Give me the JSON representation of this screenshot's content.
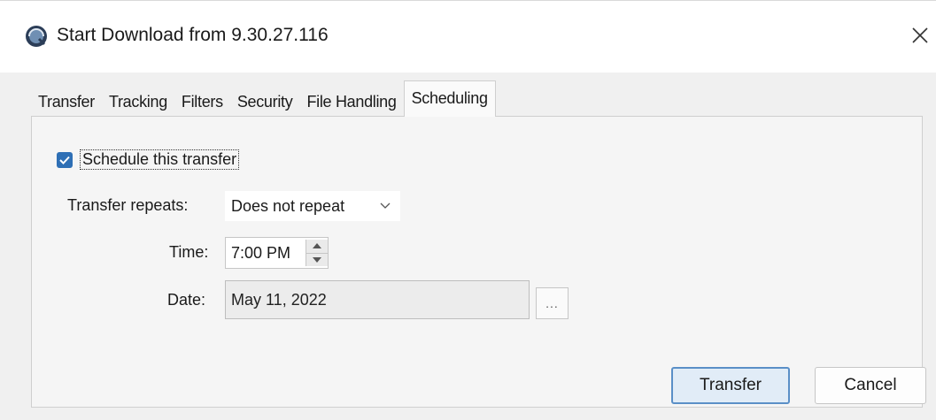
{
  "window": {
    "title": "Start Download from 9.30.27.116",
    "app_icon": "app-globe-icon",
    "close_icon": "close-icon"
  },
  "tabs": [
    {
      "label": "Transfer",
      "active": false
    },
    {
      "label": "Tracking",
      "active": false
    },
    {
      "label": "Filters",
      "active": false
    },
    {
      "label": "Security",
      "active": false
    },
    {
      "label": "File Handling",
      "active": false
    },
    {
      "label": "Scheduling",
      "active": true
    }
  ],
  "scheduling": {
    "schedule_checkbox": {
      "label": "Schedule this transfer",
      "checked": true
    },
    "repeats": {
      "label": "Transfer repeats:",
      "value": "Does not repeat"
    },
    "time": {
      "label": "Time:",
      "value": "7:00 PM"
    },
    "date": {
      "label": "Date:",
      "value": "May 11, 2022",
      "picker_label": "..."
    }
  },
  "buttons": {
    "transfer": "Transfer",
    "cancel": "Cancel"
  },
  "colors": {
    "accent": "#2e6fb5",
    "default_button_border": "#5a8fc7",
    "default_button_bg": "#e1ecf7"
  }
}
